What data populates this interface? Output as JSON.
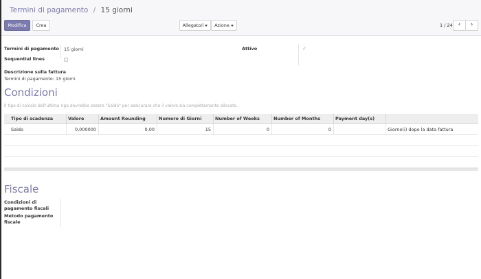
{
  "breadcrumb": {
    "parent": "Termini di pagamento",
    "separator": "/",
    "current": "15 giorni"
  },
  "toolbar": {
    "edit_label": "Modifica",
    "create_label": "Crea",
    "attachments_label": "Allegato/i",
    "action_label": "Azione"
  },
  "pager": {
    "value": "1 / 24",
    "prev_icon": "‹",
    "next_icon": "›"
  },
  "form": {
    "name_label": "Termini di pagamento",
    "name_value": "15 giorni",
    "sequential_label": "Sequential lines",
    "active_label": "Attivo",
    "active_check": "✓",
    "invoice_desc_label": "Descrizione sulla fattura",
    "invoice_desc_value": "Termini di pagamento: 15 giorni"
  },
  "conditions": {
    "title": "Condizioni",
    "hint": "Il tipo di calcolo dell'ultima riga dovrebbe essere \"Saldo\" per assicurare che il valore sia completamente allocato.",
    "columns": [
      "Tipo di scadenza",
      "Valore",
      "Amount Rounding",
      "Numero di Giorni",
      "Number of Weeks",
      "Number of Months",
      "Payment day(s)"
    ],
    "rows": [
      {
        "type": "Saldo",
        "value": "0,000000",
        "rounding": "0,00",
        "days": "15",
        "weeks": "0",
        "months": "0",
        "payment_days": "Giorno(i) dopo la data fattura"
      }
    ]
  },
  "fiscal": {
    "title": "Fiscale",
    "fiscal_terms_label": "Condizioni di pagamento fiscali",
    "payment_method_label": "Metodo pagamento fiscale"
  },
  "colors": {
    "accent": "#7c7bad",
    "panel_bg": "#f7f6f8",
    "table_header_bg": "#eeeeee"
  }
}
